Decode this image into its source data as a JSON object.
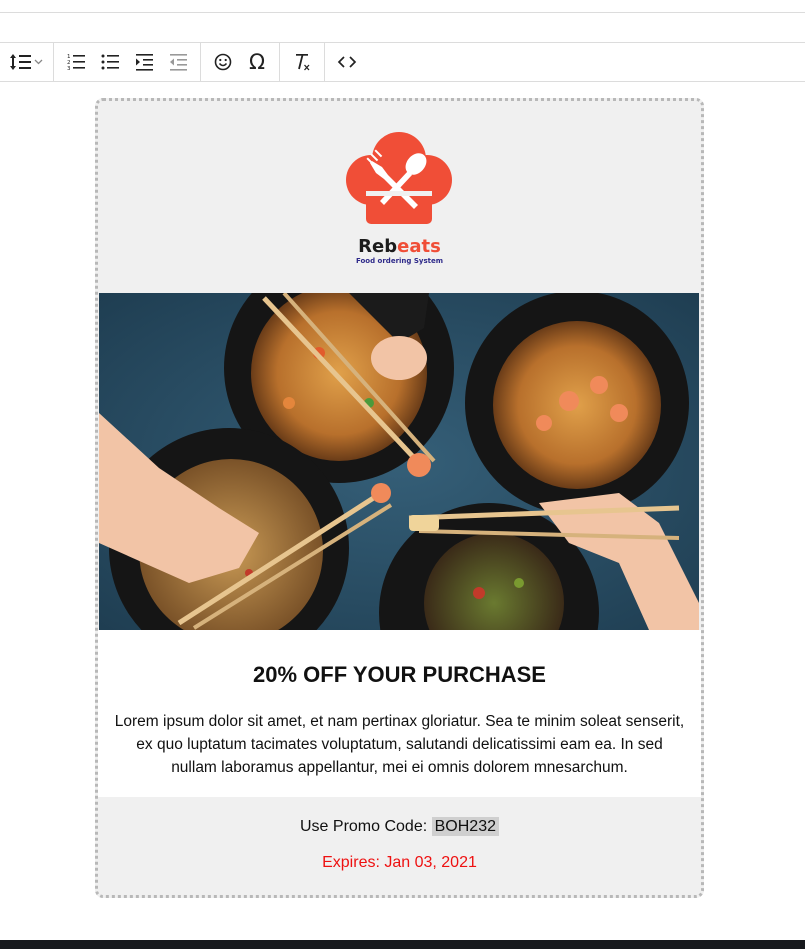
{
  "toolbar": {
    "buttons": [
      {
        "icon": "line-height-icon"
      },
      {
        "icon": "numbered-list-icon"
      },
      {
        "icon": "bullet-list-icon"
      },
      {
        "icon": "indent-icon"
      },
      {
        "icon": "outdent-icon"
      },
      {
        "icon": "emoji-icon"
      },
      {
        "icon": "special-character-icon",
        "glyph": "Ω"
      },
      {
        "icon": "clear-formatting-icon"
      },
      {
        "icon": "source-code-icon"
      }
    ]
  },
  "email": {
    "brand": {
      "name_dark": "Reb",
      "name_accent": "eats",
      "tagline": "Food ordering System",
      "accent_color": "#f04e37"
    },
    "offer": {
      "heading": "20% OFF YOUR PURCHASE",
      "body": "Lorem ipsum dolor sit amet, et nam pertinax gloriatur. Sea te minim soleat senserit, ex quo luptatum tacimates voluptatum, salutandi delicatissimi eam ea. In sed nullam laboramus appellantur, mei ei omnis dolorem mnesarchum."
    },
    "promo": {
      "label": "Use Promo Code:",
      "code": "BOH232",
      "expires": "Expires: Jan 03, 2021",
      "expires_color": "#ee1111"
    }
  }
}
